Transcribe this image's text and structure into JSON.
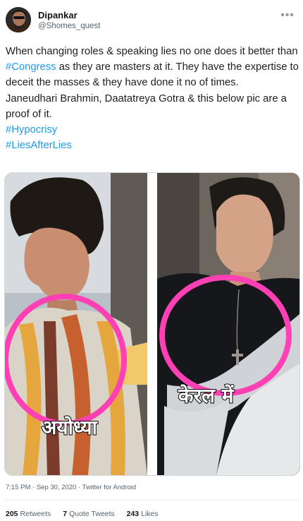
{
  "tweet": {
    "author_name": "Dipankar",
    "author_handle": "@Shomes_quest",
    "more_glyph": "•••",
    "text_parts": [
      "When changing roles & speaking lies no one does it better than ",
      "#Congress",
      " as they are masters at it. They have the expertise to deceit the masses & they have done it no of times.",
      "Janeudhari Brahmin, Daatatreya Gotra & this below pic are a proof of it.",
      "#Hypocrisy",
      "#LiesAfterLies"
    ],
    "link_color": "#1d9bf0",
    "media": {
      "left_caption": "अयोध्या",
      "right_caption": "केरल में",
      "circle_color": "#ff3fb4"
    },
    "timestamp": "7:15 PM · Sep 30, 2020 · Twitter for Android",
    "stats": {
      "retweets_count": "205",
      "retweets_label": "Retweets",
      "quotes_count": "7",
      "quotes_label": "Quote Tweets",
      "likes_count": "243",
      "likes_label": "Likes"
    }
  }
}
